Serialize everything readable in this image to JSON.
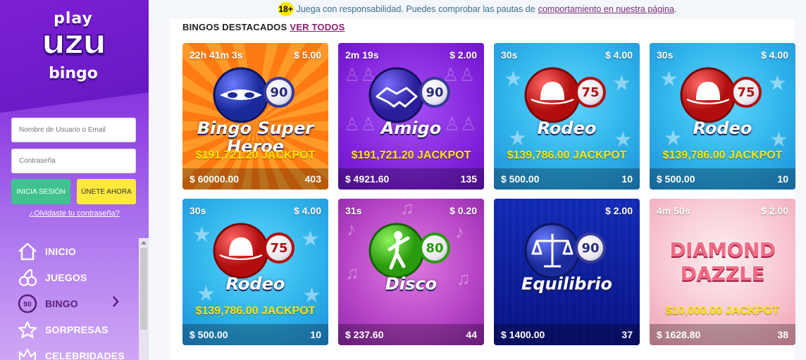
{
  "brand": {
    "line1": "play",
    "line2": "uzu",
    "line3": "bingo"
  },
  "login": {
    "username_placeholder": "Nombre de Usuario o Email",
    "password_placeholder": "Contraseña",
    "login_label": "INICIA SESIÓN",
    "join_label": "ÚNETE AHORA",
    "forgot_label": "¿Olvidaste tu contraseña?"
  },
  "nav": [
    {
      "label": "INICIO",
      "icon": "home-icon"
    },
    {
      "label": "JUEGOS",
      "icon": "cherries-icon"
    },
    {
      "label": "BINGO",
      "icon": "bingo-ball-icon",
      "ball_number": "90"
    },
    {
      "label": "SORPRESAS",
      "icon": "star-icon"
    },
    {
      "label": "CELEBRIDADES",
      "icon": "crown-icon"
    }
  ],
  "topbar": {
    "age_badge": "18+",
    "message": "Juega con responsabilidad. Puedes comprobar las pautas de",
    "link": "comportamiento en nuestra página",
    "suffix": "."
  },
  "section": {
    "title": "BINGOS DESTACADOS",
    "link": "VER TODOS"
  },
  "cards": [
    {
      "timer": "22h 41m 3s",
      "price": "$ 5.00",
      "name": "Bingo Super Heroe",
      "ball": "90",
      "jackpot": "$191,721.20 JACKPOT",
      "prize": "$ 60000.00",
      "players": "403",
      "theme": "orange",
      "colors": {
        "bg1": "#ff8a1a",
        "bg2": "#e0260c"
      }
    },
    {
      "timer": "2m 19s",
      "price": "$ 2.00",
      "name": "Amigo",
      "ball": "90",
      "jackpot": "$191,721.20 JACKPOT",
      "prize": "$ 4921.60",
      "players": "135",
      "theme": "purple",
      "colors": {
        "bg1": "#9b3cf0",
        "bg2": "#6a16c6"
      }
    },
    {
      "timer": "30s",
      "price": "$ 4.00",
      "name": "Rodeo",
      "ball": "75",
      "jackpot": "$139,786.00 JACKPOT",
      "prize": "$ 500.00",
      "players": "10",
      "theme": "blue",
      "colors": {
        "bg1": "#3fc6f4",
        "bg2": "#1f8fd8"
      }
    },
    {
      "timer": "30s",
      "price": "$ 4.00",
      "name": "Rodeo",
      "ball": "75",
      "jackpot": "$139,786.00 JACKPOT",
      "prize": "$ 500.00",
      "players": "10",
      "theme": "blue",
      "colors": {
        "bg1": "#3fc6f4",
        "bg2": "#1f8fd8"
      }
    },
    {
      "timer": "30s",
      "price": "$ 4.00",
      "name": "Rodeo",
      "ball": "75",
      "jackpot": "$139,786.00 JACKPOT",
      "prize": "$ 500.00",
      "players": "10",
      "theme": "blue",
      "colors": {
        "bg1": "#3fc6f4",
        "bg2": "#1f8fd8"
      }
    },
    {
      "timer": "31s",
      "price": "$ 0.20",
      "name": "Disco",
      "ball": "80",
      "jackpot": "",
      "prize": "$ 237.60",
      "players": "44",
      "theme": "magenta",
      "colors": {
        "bg1": "#d55ad8",
        "bg2": "#9b2fb3"
      }
    },
    {
      "timer": "",
      "price": "$ 2.00",
      "name": "Equilibrio",
      "ball": "90",
      "jackpot": "",
      "prize": "$ 1400.00",
      "players": "37",
      "theme": "navy",
      "colors": {
        "bg1": "#4a6ed8",
        "bg2": "#2a2f9a"
      }
    },
    {
      "timer": "4m 50s",
      "price": "$ 2.00",
      "name": "DIAMOND DAZZLE",
      "ball": "",
      "jackpot": "$10,000.00 JACKPOT",
      "prize": "$ 1628.80",
      "players": "38",
      "theme": "pink",
      "colors": {
        "bg1": "#fbe0e4",
        "bg2": "#f4a9b8"
      }
    }
  ]
}
